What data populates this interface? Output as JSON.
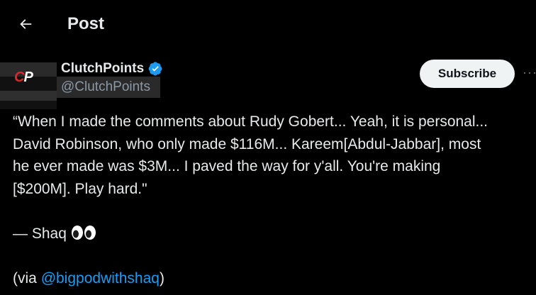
{
  "header": {
    "title": "Post",
    "back_icon": "arrow-left-icon"
  },
  "author": {
    "name": "ClutchPoints",
    "handle": "@ClutchPoints",
    "verified": true,
    "verified_color": "#1d9bf0",
    "avatar_text_c": "C",
    "avatar_text_p": "P"
  },
  "actions": {
    "subscribe_label": "Subscribe",
    "more_label": "···"
  },
  "post": {
    "line1": "“When I made the comments about Rudy Gobert... Yeah, it is personal...",
    "line2": "David Robinson, who only made $116M... Kareem[Abdul-Jabbar], most",
    "line3": "he ever made was $3M... I paved the way for y'all. You're making",
    "line4": "[$200M]. Play hard.\"",
    "signature": "— Shaq",
    "signature_emoji": "eyes-emoji",
    "via_prefix": "(via ",
    "via_mention": "@bigpodwithshaq",
    "via_suffix": ")"
  },
  "colors": {
    "background": "#000000",
    "text": "#e7e9ea",
    "secondary_text": "#8b98a5",
    "link": "#1d9bf0",
    "button_bg": "#eff3f4"
  }
}
